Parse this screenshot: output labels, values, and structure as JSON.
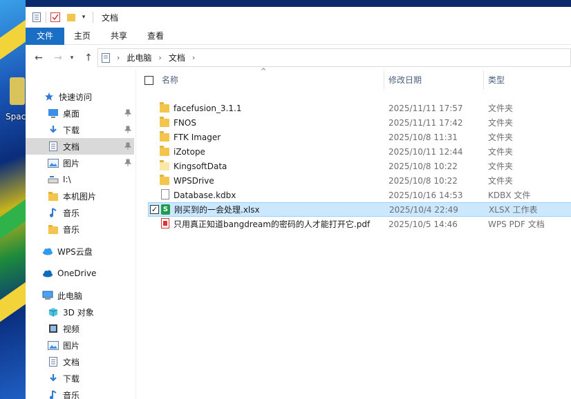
{
  "desktop": {
    "icon_label": "Spac"
  },
  "window": {
    "title": "文档"
  },
  "ribbon": {
    "tabs": [
      "文件",
      "主页",
      "共享",
      "查看"
    ]
  },
  "address": {
    "crumbs": [
      "此电脑",
      "文档"
    ]
  },
  "nav": {
    "items": [
      {
        "label": "快速访问",
        "icon": "star-icon",
        "pinned": false
      },
      {
        "label": "桌面",
        "icon": "desktop-icon",
        "pinned": true
      },
      {
        "label": "下载",
        "icon": "download-icon",
        "pinned": true
      },
      {
        "label": "文档",
        "icon": "document-icon",
        "pinned": true,
        "selected": true
      },
      {
        "label": "图片",
        "icon": "picture-icon",
        "pinned": true
      },
      {
        "label": "I:\\",
        "icon": "drive-icon",
        "pinned": false
      },
      {
        "label": "本机图片",
        "icon": "folder-icon",
        "pinned": false
      },
      {
        "label": "音乐",
        "icon": "music-icon",
        "pinned": false
      },
      {
        "label": "音乐",
        "icon": "folder-icon",
        "pinned": false
      },
      {
        "label": "WPS云盘",
        "icon": "cloud-icon",
        "pinned": false
      },
      {
        "label": "OneDrive",
        "icon": "onedrive-icon",
        "pinned": false
      },
      {
        "label": "此电脑",
        "icon": "computer-icon",
        "pinned": false
      },
      {
        "label": "3D 对象",
        "icon": "cube-icon",
        "pinned": false
      },
      {
        "label": "视频",
        "icon": "video-icon",
        "pinned": false
      },
      {
        "label": "图片",
        "icon": "picture-icon",
        "pinned": false
      },
      {
        "label": "文档",
        "icon": "document-icon",
        "pinned": false
      },
      {
        "label": "下载",
        "icon": "download-icon",
        "pinned": false
      },
      {
        "label": "音乐",
        "icon": "music-icon",
        "pinned": false
      }
    ]
  },
  "columns": {
    "name": "名称",
    "date": "修改日期",
    "type": "类型"
  },
  "files": [
    {
      "name": "facefusion_3.1.1",
      "date": "2025/11/11 17:57",
      "type": "文件夹",
      "kind": "folder"
    },
    {
      "name": "FNOS",
      "date": "2025/11/11 17:42",
      "type": "文件夹",
      "kind": "folder"
    },
    {
      "name": "FTK Imager",
      "date": "2025/10/8 11:31",
      "type": "文件夹",
      "kind": "folder"
    },
    {
      "name": "iZotope",
      "date": "2025/10/11 12:44",
      "type": "文件夹",
      "kind": "folder"
    },
    {
      "name": "KingsoftData",
      "date": "2025/10/8 10:22",
      "type": "文件夹",
      "kind": "folder-pale"
    },
    {
      "name": "WPSDrive",
      "date": "2025/10/8 10:22",
      "type": "文件夹",
      "kind": "folder"
    },
    {
      "name": "Database.kdbx",
      "date": "2025/10/16 14:53",
      "type": "KDBX 文件",
      "kind": "file"
    },
    {
      "name": "刚买到的一会处理.xlsx",
      "date": "2025/10/4 22:49",
      "type": "XLSX 工作表",
      "kind": "xlsx",
      "selected": true
    },
    {
      "name": "只用真正知道bangdream的密码的人才能打开它.pdf",
      "date": "2025/10/5 14:46",
      "type": "WPS PDF 文档",
      "kind": "pdf"
    }
  ],
  "colors": {
    "accent": "#1a6fc4",
    "selected_row": "#cce8ff",
    "nav_selected": "#d9d9d9"
  }
}
